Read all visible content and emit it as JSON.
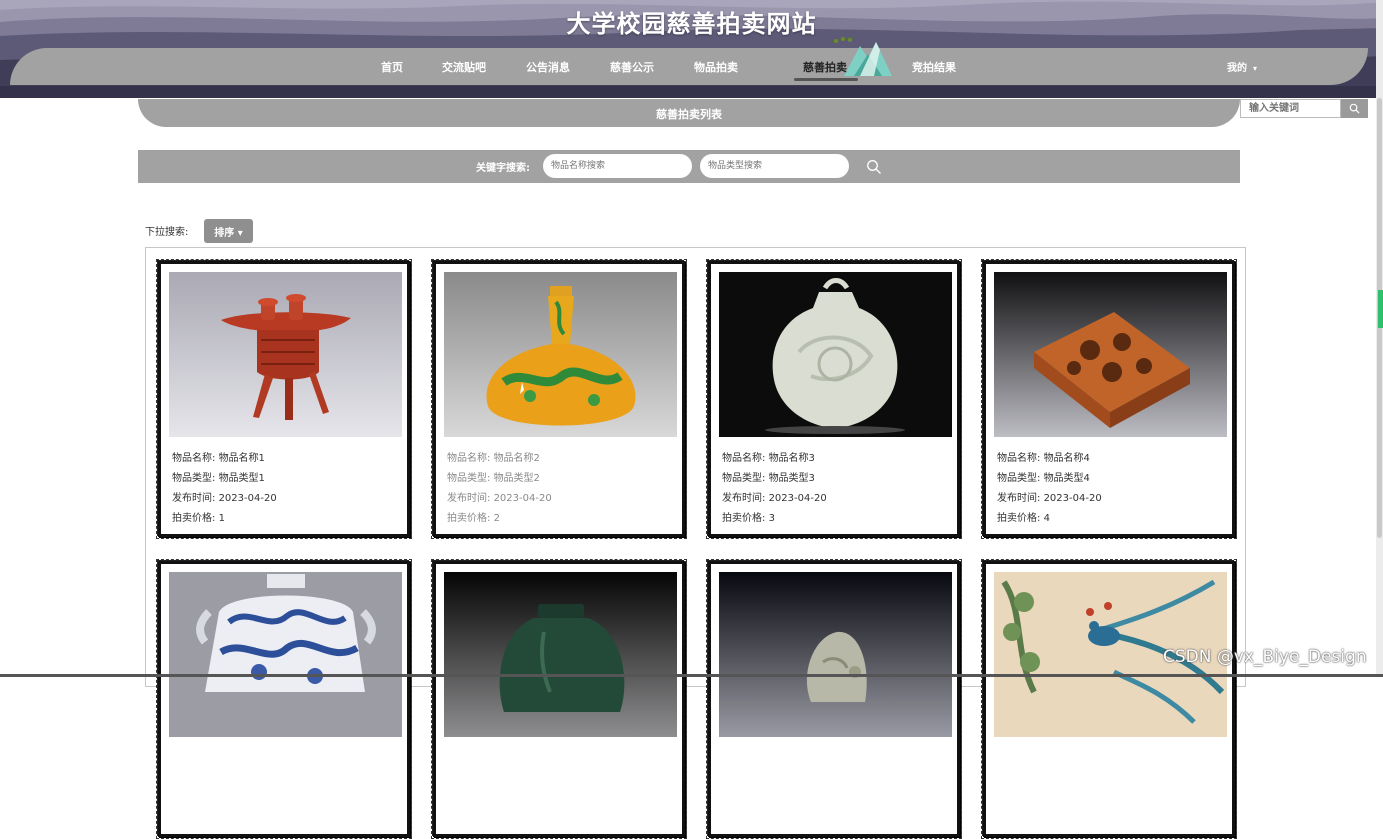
{
  "header": {
    "site_title": "大学校园慈善拍卖网站",
    "nav": [
      {
        "label": "首页"
      },
      {
        "label": "交流贴吧"
      },
      {
        "label": "公告消息"
      },
      {
        "label": "慈善公示"
      },
      {
        "label": "物品拍卖"
      },
      {
        "label": "慈善拍卖",
        "active": true
      },
      {
        "label": "竞拍结果"
      }
    ],
    "user_menu": "我的",
    "caret": "▾"
  },
  "section": {
    "title": "慈善拍卖列表"
  },
  "top_search": {
    "placeholder": "输入关键词"
  },
  "search": {
    "label": "关键字搜索:",
    "name_placeholder": "物品名称搜索",
    "type_placeholder": "物品类型搜索"
  },
  "sort": {
    "label": "下拉搜索:",
    "button": "排序 ▾"
  },
  "items": [
    {
      "name_label": "物品名称:",
      "name": "物品名称1",
      "type_label": "物品类型:",
      "type": "物品类型1",
      "time_label": "发布时间:",
      "time": "2023-04-20",
      "price_label": "拍卖价格:",
      "price": "1",
      "image": "red-lacquer-tripod-vessel"
    },
    {
      "name_label": "物品名称:",
      "name": "物品名称2",
      "type_label": "物品类型:",
      "type": "物品类型2",
      "time_label": "发布时间:",
      "time": "2023-04-20",
      "price_label": "拍卖价格:",
      "price": "2",
      "image": "yellow-dragon-vase"
    },
    {
      "name_label": "物品名称:",
      "name": "物品名称3",
      "type_label": "物品类型:",
      "type": "物品类型3",
      "time_label": "发布时间:",
      "time": "2023-04-20",
      "price_label": "拍卖价格:",
      "price": "3",
      "image": "white-jade-pendant"
    },
    {
      "name_label": "物品名称:",
      "name": "物品名称4",
      "type_label": "物品类型:",
      "type": "物品类型4",
      "time_label": "发布时间:",
      "time": "2023-04-20",
      "price_label": "拍卖价格:",
      "price": "4",
      "image": "carved-wood-stand"
    },
    {
      "image": "blue-white-porcelain-flask"
    },
    {
      "image": "green-jade-jar"
    },
    {
      "image": "crystal-stone"
    },
    {
      "image": "peacock-painting"
    }
  ],
  "watermark": "CSDN @vx_Biye_Design",
  "colors": {
    "bar_gray": "#a2a2a2",
    "header_purple": "#8d8aa0"
  }
}
